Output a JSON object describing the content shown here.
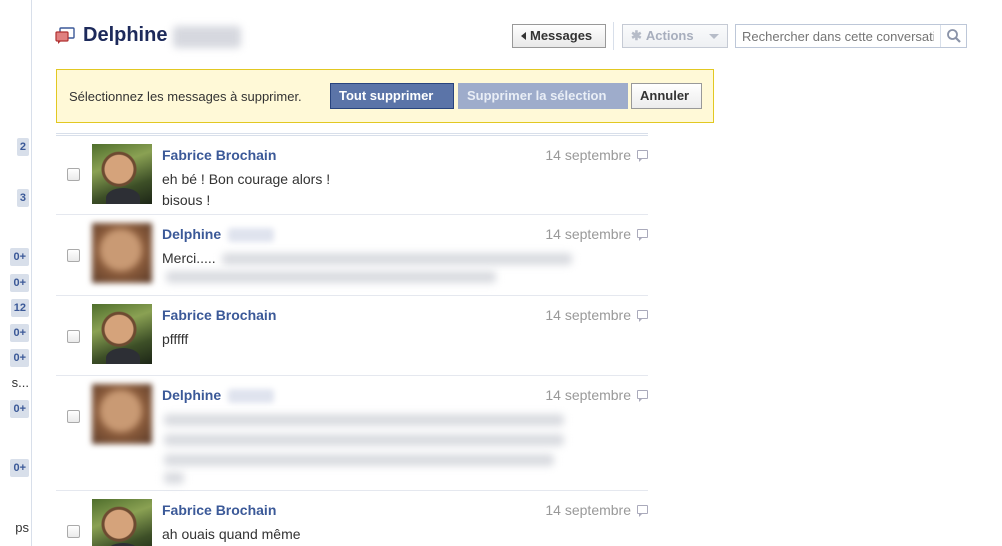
{
  "sidebar": {
    "counters": [
      "2",
      "3",
      "0+",
      "0+",
      "12",
      "0+",
      "0+",
      "s...",
      "0+",
      "0+",
      "ps"
    ]
  },
  "header": {
    "title": "Delphine",
    "messages_button": "Messages",
    "actions_button": "Actions",
    "search_placeholder": "Rechercher dans cette conversation"
  },
  "selection_bar": {
    "prompt": "Sélectionnez les messages à supprimer.",
    "delete_all": "Tout supprimer",
    "delete_selection": "Supprimer la sélection",
    "cancel": "Annuler"
  },
  "messages": [
    {
      "author": "Fabrice Brochain",
      "date": "14 septembre",
      "lines": [
        "eh bé ! Bon courage alors !",
        "bisous !"
      ]
    },
    {
      "author": "Delphine",
      "date": "14 septembre",
      "lines": [
        "Merci....."
      ]
    },
    {
      "author": "Fabrice Brochain",
      "date": "14 septembre",
      "lines": [
        "pfffff"
      ]
    },
    {
      "author": "Delphine",
      "date": "14 septembre",
      "lines": []
    },
    {
      "author": "Fabrice Brochain",
      "date": "14 septembre",
      "lines": [
        "ah ouais quand même"
      ]
    }
  ],
  "colors": {
    "brand_blue": "#3b5998",
    "selection_bar_bg": "#fff9d7",
    "selection_bar_border": "#e2c822"
  }
}
